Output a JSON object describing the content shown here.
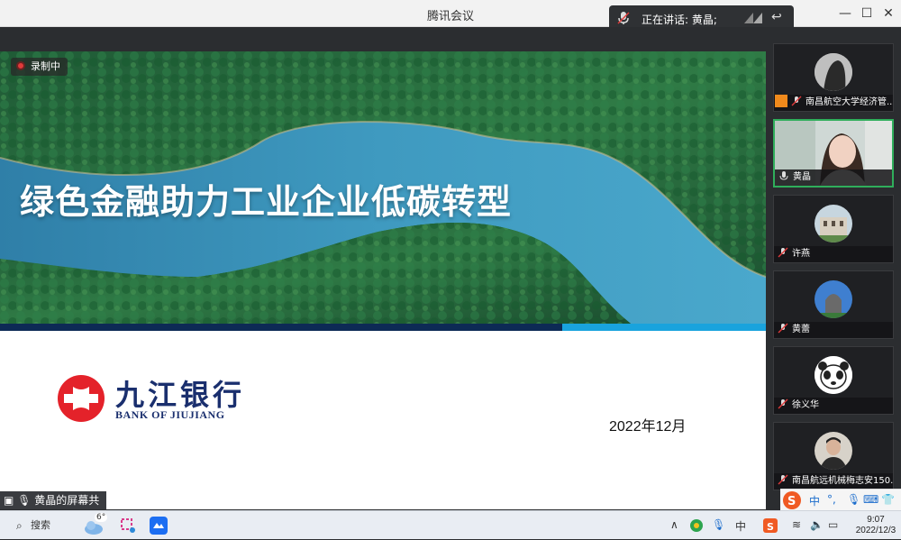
{
  "window": {
    "title": "腾讯会议",
    "minimize": "—",
    "maximize": "☐",
    "close": "✕"
  },
  "speaking": {
    "label": "正在讲话: 黄晶;"
  },
  "recording": {
    "label": "录制中"
  },
  "slide": {
    "title": "绿色金融助力工业企业低碳转型",
    "bank_name_cn": "九江银行",
    "bank_name_en": "BANK OF JIUJIANG",
    "date": "2022年12月"
  },
  "screenshare": {
    "label": "黄晶的屏幕共享"
  },
  "participants": [
    {
      "name": "南昌航空大学经济管..."
    },
    {
      "name": "黄晶"
    },
    {
      "name": "许燕"
    },
    {
      "name": "黄蕾"
    },
    {
      "name": "徐义华"
    },
    {
      "name": "南昌航远机械梅志安150..."
    }
  ],
  "ime": {
    "lang": "中",
    "punct": "°,"
  },
  "taskbar": {
    "search": "搜索",
    "weather_temp": "6°",
    "ime_lang": "中",
    "time": "9:07",
    "date": "2022/12/3"
  },
  "colors": {
    "slide_bar_dark": "#0d2a55",
    "slide_bar_light": "#19a3dd",
    "bank_red": "#e4222a",
    "bank_navy": "#1a2f6e",
    "active_speaker": "#2fae5b"
  }
}
